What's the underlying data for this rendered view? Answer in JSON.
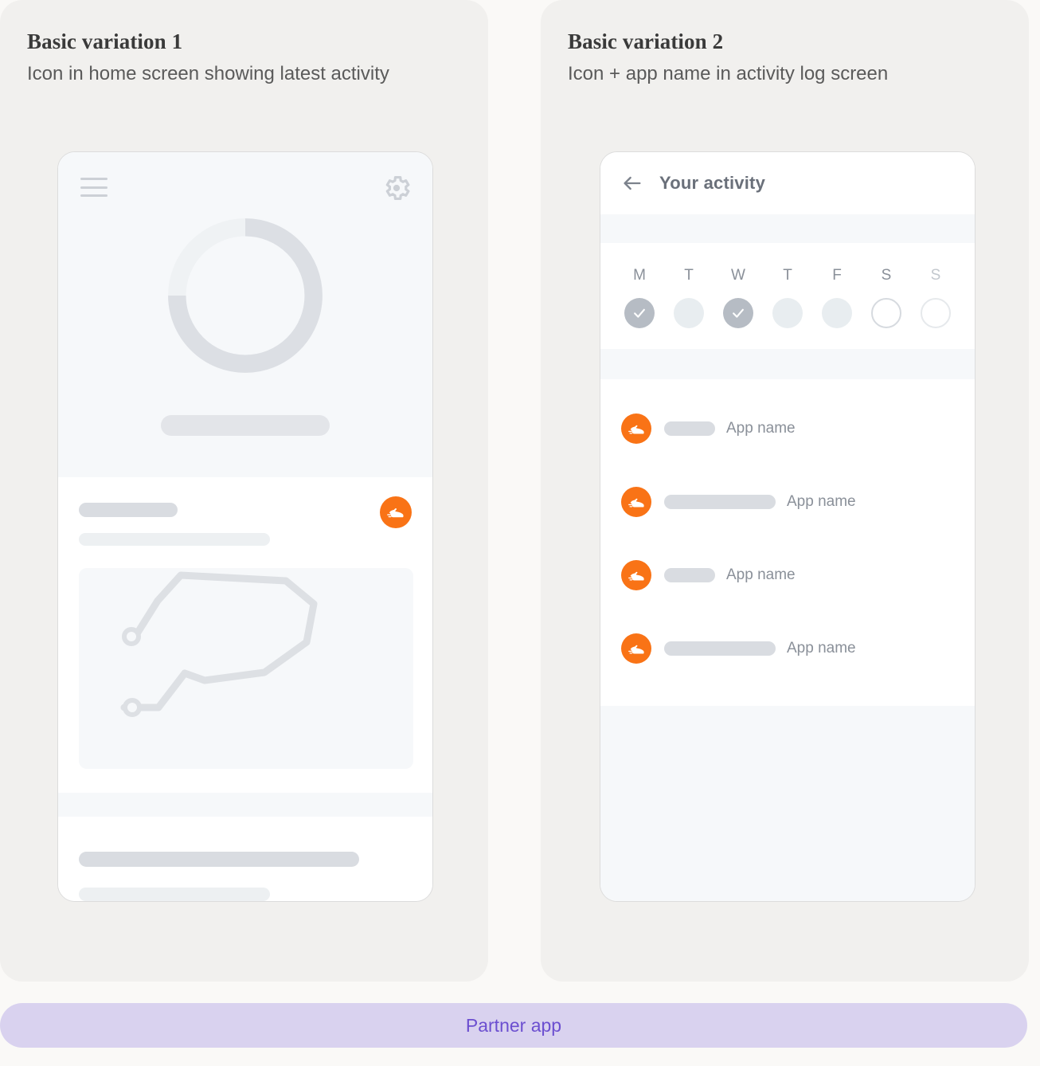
{
  "page": {
    "background_color": "#FAF9F7",
    "accent_color": "#F97316",
    "banner_color": "#D9D2EF",
    "banner_text_color": "#6C4FD0"
  },
  "panels": [
    {
      "title": "Basic variation 1",
      "subtitle": "Icon in home screen showing latest activity",
      "phone": {
        "menu_icon": "hamburger-menu-icon",
        "settings_icon": "gear-icon",
        "progress_ring": {
          "value_percent": 75,
          "track_color": "#EDF0F2",
          "progress_color": "#DCDFE4"
        },
        "app_icon": "running-shoe-icon",
        "map_icon": "route-path-icon"
      }
    },
    {
      "title": "Basic variation 2",
      "subtitle": "Icon + app name in activity log screen",
      "phone": {
        "back_icon": "back-arrow-icon",
        "header_title": "Your activity",
        "week": {
          "days": [
            {
              "label": "M",
              "state": "done"
            },
            {
              "label": "T",
              "state": "idle"
            },
            {
              "label": "W",
              "state": "done"
            },
            {
              "label": "T",
              "state": "idle"
            },
            {
              "label": "F",
              "state": "idle"
            },
            {
              "label": "S",
              "state": "empty"
            },
            {
              "label": "S",
              "state": "empty-faint"
            }
          ],
          "check_icon": "check-icon"
        },
        "activities": [
          {
            "app_icon": "running-shoe-icon",
            "pill": "short",
            "app_name": "App name"
          },
          {
            "app_icon": "running-shoe-icon",
            "pill": "long",
            "app_name": "App name"
          },
          {
            "app_icon": "running-shoe-icon",
            "pill": "short",
            "app_name": "App name"
          },
          {
            "app_icon": "running-shoe-icon",
            "pill": "long",
            "app_name": "App name"
          }
        ]
      }
    }
  ],
  "banner": {
    "label": "Partner app"
  }
}
